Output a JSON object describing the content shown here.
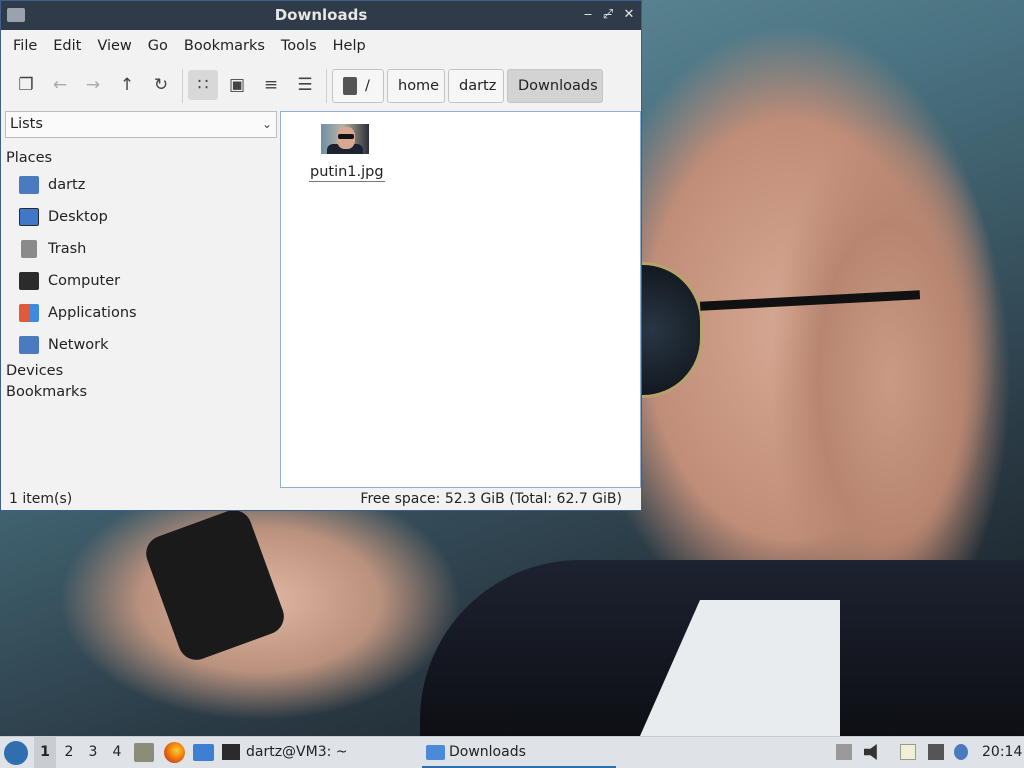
{
  "window": {
    "title": "Downloads",
    "controls": {
      "minimize": "‒",
      "maximize": "⤢",
      "close": "✕"
    }
  },
  "menubar": [
    "File",
    "Edit",
    "View",
    "Go",
    "Bookmarks",
    "Tools",
    "Help"
  ],
  "toolbar": {
    "icons": [
      "new-tab-icon",
      "back-icon",
      "forward-icon",
      "up-icon",
      "reload-icon",
      "icon-view-icon",
      "thumbnail-view-icon",
      "compact-view-icon",
      "detailed-list-icon"
    ],
    "glyphs": {
      "new_tab": "❐",
      "back": "←",
      "forward": "→",
      "up": "↑",
      "reload": "↻",
      "icon_view": "∷",
      "thumb_view": "▣",
      "compact_view": "≡",
      "list_view": "☰"
    }
  },
  "breadcrumb": {
    "root": "/",
    "items": [
      "home",
      "dartz",
      "Downloads"
    ]
  },
  "sidebar": {
    "mode": "Lists",
    "places_label": "Places",
    "places": [
      {
        "label": "dartz",
        "icon": "home-folder-icon",
        "color": "#4a7bbf"
      },
      {
        "label": "Desktop",
        "icon": "desktop-icon",
        "color": "#3f78c9"
      },
      {
        "label": "Trash",
        "icon": "trash-icon",
        "color": "#8a8a8a"
      },
      {
        "label": "Computer",
        "icon": "computer-icon",
        "color": "#2b2b2b"
      },
      {
        "label": "Applications",
        "icon": "applications-icon",
        "color": "#e05a3a"
      },
      {
        "label": "Network",
        "icon": "network-icon",
        "color": "#4a7bbf"
      }
    ],
    "devices_label": "Devices",
    "bookmarks_label": "Bookmarks"
  },
  "files": [
    {
      "name": "putin1.jpg",
      "icon": "image-thumbnail-icon"
    }
  ],
  "status": {
    "count": "1 item(s)",
    "free_space": "Free space: 52.3 GiB (Total: 62.7 GiB)"
  },
  "taskbar": {
    "workspaces": [
      "1",
      "2",
      "3",
      "4"
    ],
    "active_workspace": "1",
    "tasks": [
      {
        "label": "dartz@VM3: ~",
        "icon": "terminal-icon"
      },
      {
        "label": "Downloads",
        "icon": "folder-icon"
      }
    ],
    "clock": "20:14"
  }
}
